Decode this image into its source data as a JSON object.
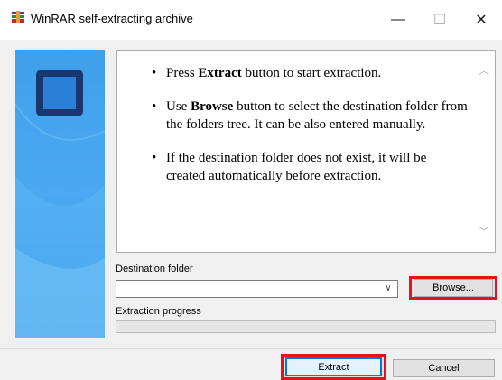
{
  "window": {
    "title": "WinRAR self-extracting archive",
    "controls": {
      "minimize": "—",
      "maximize": "☐",
      "close": "✕"
    }
  },
  "info": {
    "items": [
      {
        "pre": "Press ",
        "bold": "Extract",
        "post": " button to start extraction."
      },
      {
        "pre": "Use ",
        "bold": "Browse",
        "post": " button to select the destination folder from the folders tree. It can be also entered manually."
      },
      {
        "pre": "If the destination folder does not exist, it will be created automatically before extraction.",
        "bold": "",
        "post": ""
      }
    ]
  },
  "destination": {
    "label_accel": "D",
    "label_rest": "estination folder",
    "value": "",
    "browse_accel": "w",
    "browse_pre": "Bro",
    "browse_post": "se..."
  },
  "progress": {
    "label": "Extraction progress",
    "fraction": 0
  },
  "buttons": {
    "extract": "Extract",
    "cancel": "Cancel"
  },
  "colors": {
    "highlight_red": "#e0141e",
    "focus_blue": "#0078d7",
    "panel_blue": "#3f9fea",
    "logo_navy": "#17376e"
  }
}
